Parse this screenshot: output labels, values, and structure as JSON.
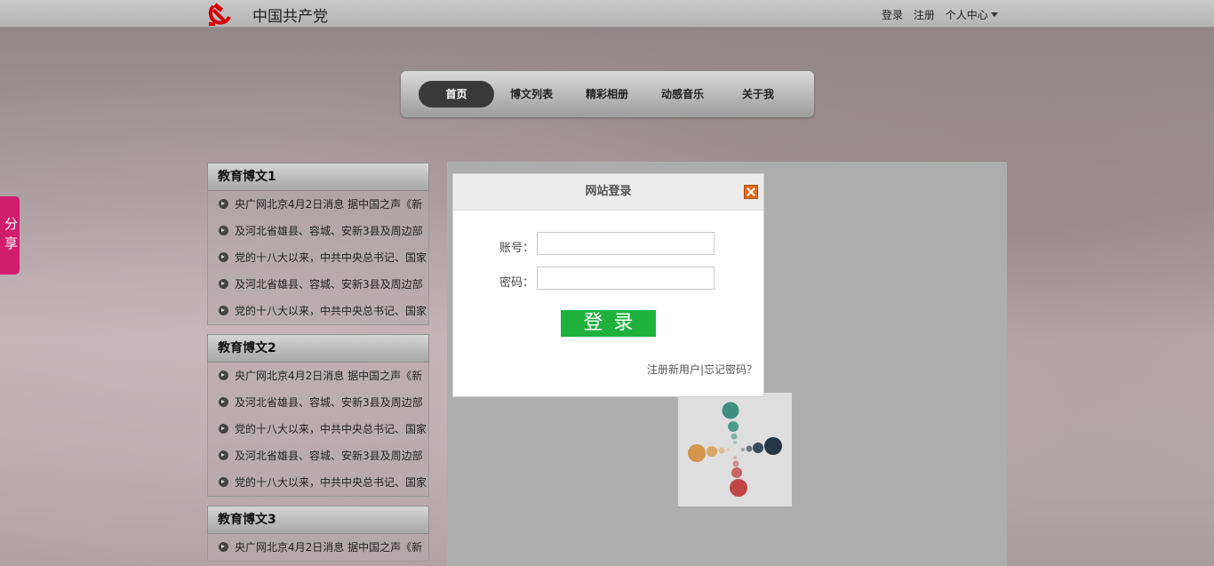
{
  "header": {
    "site_title": "中国共产党",
    "links": {
      "login": "登录",
      "register": "注册",
      "personal_center": "个人中心"
    }
  },
  "nav": {
    "items": [
      {
        "label": "首页",
        "active": true
      },
      {
        "label": "博文列表",
        "active": false
      },
      {
        "label": "精彩相册",
        "active": false
      },
      {
        "label": "动感音乐",
        "active": false
      },
      {
        "label": "关于我",
        "active": false
      }
    ]
  },
  "share": {
    "label": "分享"
  },
  "blocks": [
    {
      "title": "教育博文1",
      "items": [
        "央广网北京4月2日消息 据中国之声《新",
        "及河北省雄县、容城、安新3县及周边部",
        "党的十八大以来，中共中央总书记、国家",
        "及河北省雄县、容城、安新3县及周边部",
        "党的十八大以来，中共中央总书记、国家"
      ]
    },
    {
      "title": "教育博文2",
      "items": [
        "央广网北京4月2日消息 据中国之声《新",
        "及河北省雄县、容城、安新3县及周边部",
        "党的十八大以来，中共中央总书记、国家",
        "及河北省雄县、容城、安新3县及周边部",
        "党的十八大以来，中共中央总书记、国家"
      ]
    },
    {
      "title": "教育博文3",
      "items": [
        "央广网北京4月2日消息 据中国之声《新"
      ]
    }
  ],
  "login_dialog": {
    "title": "网站登录",
    "account_label": "账号：",
    "account_value": "",
    "password_label": "密码：",
    "password_value": "",
    "submit_label": "登录",
    "register_link": "注册新用户",
    "separator": "|",
    "forgot_link": "忘记密码？"
  },
  "colors": {
    "share_tab": "#d11d6e",
    "login_button": "#1fb13c",
    "close_button": "#e06a1d",
    "nav_active": "#3a3a3a"
  },
  "icons": [
    "hammer-sickle-logo",
    "close-icon",
    "bullet-arrow-icon",
    "loading-spinner"
  ]
}
